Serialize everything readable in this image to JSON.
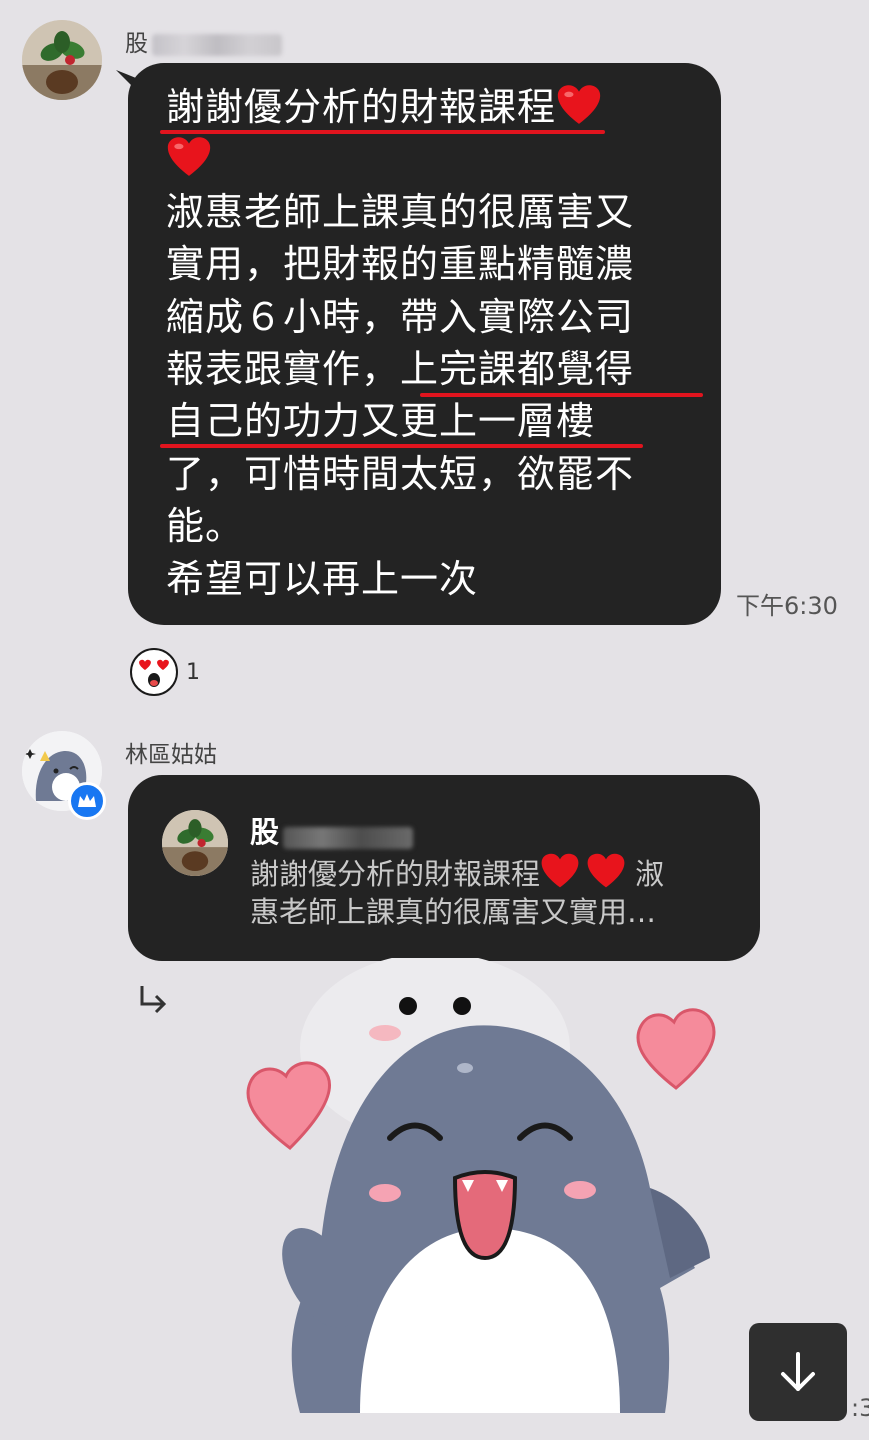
{
  "messages": [
    {
      "sender_name": "股",
      "text_lines": [
        "謝謝優分析的財報課程",
        "",
        "淑惠老師上課真的很厲害又",
        "實用，把財報的重點精髓濃",
        "縮成６小時，帶入實際公司",
        "報表跟實作，上完課都覺得",
        "自己的功力又更上一層樓",
        "了，可惜時間太短，欲罷不",
        "能。",
        "希望可以再上一次"
      ],
      "timestamp": "下午6:30",
      "reaction": {
        "icon": "heart-eyes-face-icon",
        "count": "1"
      }
    },
    {
      "sender_name": "林區姑姑",
      "quote": {
        "author": "股",
        "text_line1": "謝謝優分析的財報課程",
        "text_line1_tail": "淑",
        "text_line2": "惠老師上課真的很厲害又實用…"
      },
      "sticker": "shark-heart-sticker"
    }
  ],
  "edge_time_fragment": ":3",
  "colors": {
    "background": "#e4e2e6",
    "bubble": "#232323",
    "underline": "#e1141e",
    "heart": "#e8141c",
    "verified_badge": "#1877f2"
  }
}
